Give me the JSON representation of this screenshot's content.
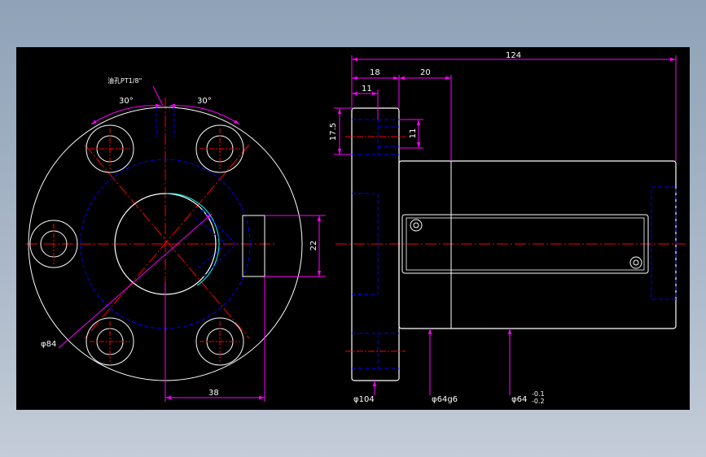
{
  "colors": {
    "background": "#000000",
    "outline": "#ffffff",
    "hidden": "#0000ff",
    "center": "#ff0000",
    "dimension": "#ff00ff",
    "thread": "#00ffff"
  },
  "front_view": {
    "note_oil_hole": "油孔PT1/8\"",
    "angle_left": "30°",
    "angle_right": "30°",
    "dia_84": "φ84",
    "dim_38": "38",
    "dim_22": "22"
  },
  "side_view": {
    "dim_124": "124",
    "dim_18": "18",
    "dim_20": "20",
    "dim_11_top": "11",
    "dim_17_5": "17.5",
    "dim_11_side": "11",
    "dia_104": "φ104",
    "dia_64g6": "φ64g6",
    "dia_64_flat": "φ64",
    "tol_upper": "-0.1",
    "tol_lower": "-0.2"
  }
}
